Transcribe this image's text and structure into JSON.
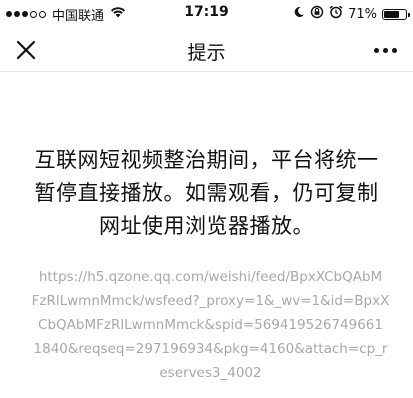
{
  "status_bar": {
    "carrier": "中国联通",
    "time": "17:19",
    "battery_percent": "71%",
    "battery_level": 0.71
  },
  "nav": {
    "title": "提示"
  },
  "message": {
    "lines": [
      "互联网短视频整治期间，平台将统一",
      "暂停直接播放。如需观看，仍可复制",
      "网址使用浏览器播放。"
    ]
  },
  "url": {
    "lines": [
      "https://h5.qzone.qq.com/weishi/feed/BpxXCbQAbM",
      "FzRlLwmnMmck/wsfeed?_proxy=1&_wv=1&id=BpxX",
      "CbQAbMFzRlLwmnMmck&spid=569419526749661",
      "1840&reqseq=297196934&pkg=4160&attach=cp_r",
      "eserves3_4002"
    ]
  },
  "colors": {
    "url_text": "#a8a8a8",
    "text": "#111111",
    "background": "#ffffff"
  }
}
